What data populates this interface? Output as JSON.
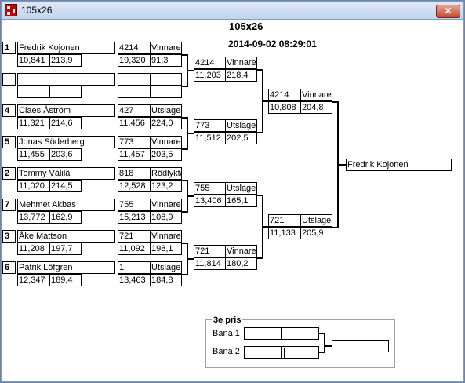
{
  "window": {
    "title": "105x26",
    "close_glyph": "✕"
  },
  "header": {
    "title": "105x26",
    "datetime": "2014-09-02 08:29:01"
  },
  "round1": [
    {
      "seed": "1",
      "name": "Fredrik Kojonen",
      "v1": "10,841",
      "v2": "213,9"
    },
    {
      "seed": "",
      "name": "",
      "v1": "",
      "v2": ""
    },
    {
      "seed": "4",
      "name": "Claes Åström",
      "v1": "11,321",
      "v2": "214,6"
    },
    {
      "seed": "5",
      "name": "Jonas Söderberg",
      "v1": "11,455",
      "v2": "203,6"
    },
    {
      "seed": "2",
      "name": "Tommy Välilä",
      "v1": "11,020",
      "v2": "214,5"
    },
    {
      "seed": "7",
      "name": "Mehmet Akbas",
      "v1": "13,772",
      "v2": "162,9"
    },
    {
      "seed": "3",
      "name": "Åke Mattson",
      "v1": "11,208",
      "v2": "197,7"
    },
    {
      "seed": "6",
      "name": "Patrik Löfgren",
      "v1": "12,347",
      "v2": "189,4"
    }
  ],
  "round2": [
    {
      "num": "4214",
      "status": "Vinnare",
      "v1": "19,320",
      "v2": "91,3"
    },
    {
      "num": "",
      "status": "",
      "v1": "",
      "v2": ""
    },
    {
      "num": "427",
      "status": "Utslagen",
      "v1": "11,456",
      "v2": "224,0"
    },
    {
      "num": "773",
      "status": "Vinnare",
      "v1": "11,457",
      "v2": "203,5"
    },
    {
      "num": "818",
      "status": "Rödlykta",
      "v1": "12,528",
      "v2": "123,2"
    },
    {
      "num": "755",
      "status": "Vinnare",
      "v1": "15,213",
      "v2": "108,9"
    },
    {
      "num": "721",
      "status": "Vinnare",
      "v1": "11,092",
      "v2": "198,1"
    },
    {
      "num": "1",
      "status": "Utslagen",
      "v1": "13,463",
      "v2": "184,8"
    }
  ],
  "round3": [
    {
      "num": "4214",
      "status": "Vinnare",
      "v1": "11,203",
      "v2": "218,4"
    },
    {
      "num": "773",
      "status": "Utslagen",
      "v1": "11,512",
      "v2": "202,5"
    },
    {
      "num": "755",
      "status": "Utslagen",
      "v1": "13,406",
      "v2": "165,1"
    },
    {
      "num": "721",
      "status": "Vinnare",
      "v1": "11,814",
      "v2": "180,2"
    }
  ],
  "round4": [
    {
      "num": "4214",
      "status": "Vinnare",
      "v1": "10,808",
      "v2": "204,8"
    },
    {
      "num": "721",
      "status": "Utslagen",
      "v1": "11,133",
      "v2": "205,9"
    }
  ],
  "final": {
    "winner": "Fredrik Kojonen"
  },
  "third_place": {
    "title": "3e pris",
    "lane1": "Bana 1",
    "lane2": "Bana 2"
  }
}
